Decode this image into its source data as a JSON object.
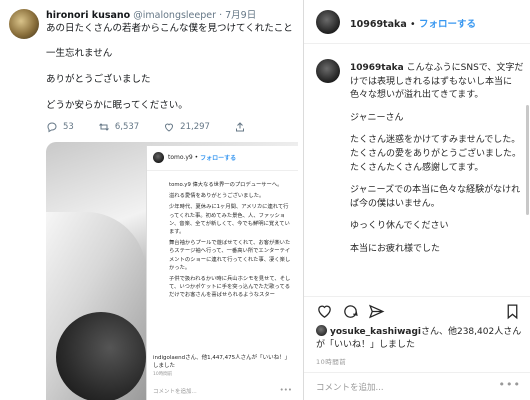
{
  "tweet": {
    "display_name": "hironori kusano",
    "handle": "@imalongsleeper",
    "separator": "·",
    "date": "7月9日",
    "lines": [
      "あの日たくさんの若者からこんな僕を見つけてくれたこと",
      "一生忘れません",
      "ありがとうございました",
      "どうか安らかに眠ってください。"
    ],
    "actions": {
      "replies": "53",
      "retweets": "6,537",
      "likes": "21,297"
    },
    "embedded_ig": {
      "username": "tomo.y9",
      "follow_label": "フォローする",
      "caption_lines": [
        "tomo.y9 偉大なる世界一のプロデューサーへ。",
        "溢れる愛情をありがとうございました。",
        "少年時代、夏休みに1ヶ月間、アメリカに連れて行ってくれた事。初めてみた景色、人、ファッション、音楽、全てが新しくて、今でも鮮明に覚えています。",
        "舞台袖からプールで遊ばせてくれて、お客が楽いたらステージ袖へ行って、一番高い所でエンターテイメントのショーに連れて行ってくれた事、凄く楽しかった。",
        "子供で扱われるかい時に兵山ホシモを見せて、そして、いつかポケットに手を突っ込んでただ歌ってるだけでお客さんを喜ばせられるようなスター"
      ],
      "liked_by_line": "indigolaendさん、他1,447,475人さんが「いいね！」しました",
      "time": "10時間前",
      "comment_placeholder": "コメントを追加..."
    }
  },
  "instagram": {
    "username": "10969taka",
    "separator": "•",
    "follow_label": "フォローする",
    "caption": {
      "author": "10969taka",
      "paragraphs": [
        "こんなふうにSNSで、文字だけでは表現しきれるはずもないし本当に色々な想いが溢れ出てきてます。",
        "ジャニーさん",
        "たくさん迷惑をかけてすみませんでした。たくさんの愛をありがとうございました。たくさんたくさん感謝してます。",
        "ジャニーズでの本当に色々な経験がなければ今の僕はいません。",
        "ゆっくり休んでください",
        "本当にお疲れ様でした"
      ]
    },
    "liked_by": {
      "user": "yosuke_kashiwagi",
      "rest": "さん、他238,402人さんが「いいね！」しました"
    },
    "time": "10時間前",
    "comment_placeholder": "コメントを追加...",
    "more_label": "•••"
  }
}
